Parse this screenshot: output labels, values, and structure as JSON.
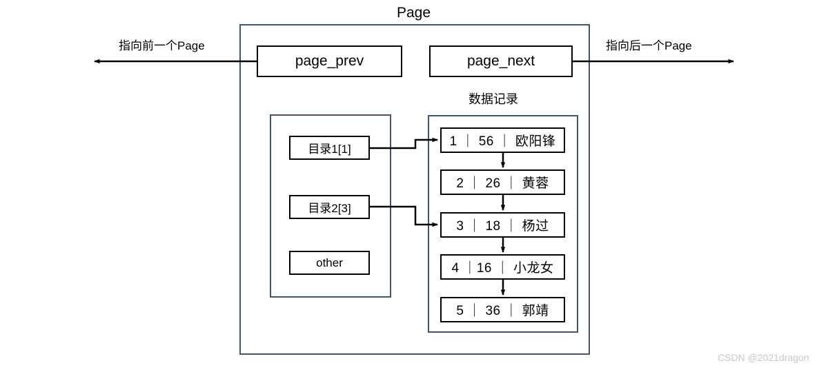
{
  "diagram": {
    "title": "Page",
    "watermark": "CSDN @2021dragon",
    "left_arrow_label": "指向前一个Page",
    "right_arrow_label": "指向后一个Page",
    "pointer_boxes": {
      "prev": "page_prev",
      "next": "page_next"
    },
    "directory_panel": {
      "items": [
        {
          "label": "目录1[1]"
        },
        {
          "label": "目录2[3]"
        },
        {
          "label": "other"
        }
      ]
    },
    "records_panel": {
      "title": "数据记录",
      "rows": [
        {
          "id": "1",
          "value": "56",
          "name": "欧阳锋",
          "text": "1  ｜  56  ｜  欧阳锋"
        },
        {
          "id": "2",
          "value": "26",
          "name": "黄蓉",
          "text": "2  ｜  26  ｜  黄蓉"
        },
        {
          "id": "3",
          "value": "18",
          "name": "杨过",
          "text": "3  ｜  18  ｜  杨过"
        },
        {
          "id": "4",
          "value": "16",
          "name": "小龙女",
          "text": "4 ｜16 ｜ 小龙女"
        },
        {
          "id": "5",
          "value": "36",
          "name": "郭靖",
          "text": "5  ｜  36  ｜  郭靖"
        }
      ]
    },
    "colors": {
      "frame": "#44556b",
      "box_border": "#000000",
      "text": "#000000",
      "watermark": "#c8c8c8",
      "background": "#ffffff"
    }
  }
}
